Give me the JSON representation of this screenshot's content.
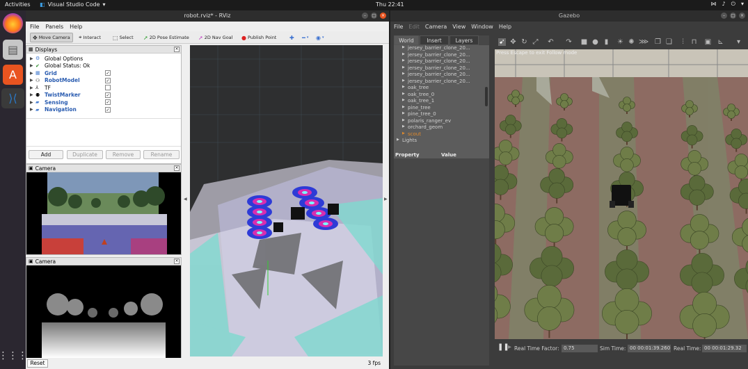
{
  "topbar": {
    "activities": "Activities",
    "app_name": "Visual Studio Code",
    "clock": "Thu 22:41"
  },
  "rviz": {
    "title": "robot.rviz* - RViz",
    "menu": [
      "File",
      "Panels",
      "Help"
    ],
    "tools": {
      "move_camera": "Move Camera",
      "interact": "Interact",
      "select": "Select",
      "pose_estimate": "2D Pose Estimate",
      "nav_goal": "2D Nav Goal",
      "publish_point": "Publish Point"
    },
    "displays": {
      "title": "Displays",
      "items": [
        {
          "label": "Global Options",
          "checked": "",
          "blue": false
        },
        {
          "label": "Global Status: Ok",
          "checked": "",
          "blue": false
        },
        {
          "label": "Grid",
          "checked": "✓",
          "blue": true
        },
        {
          "label": "RobotModel",
          "checked": "✓",
          "blue": true
        },
        {
          "label": "TF",
          "checked": "",
          "blue": false
        },
        {
          "label": "TwistMarker",
          "checked": "✓",
          "blue": true
        },
        {
          "label": "Sensing",
          "checked": "✓",
          "blue": true
        },
        {
          "label": "Navigation",
          "checked": "✓",
          "blue": true
        }
      ],
      "buttons": {
        "add": "Add",
        "duplicate": "Duplicate",
        "remove": "Remove",
        "rename": "Rename"
      }
    },
    "camera1_title": "Camera",
    "camera2_title": "Camera",
    "status": {
      "reset": "Reset",
      "fps": "3 fps"
    }
  },
  "gazebo": {
    "title": "Gazebo",
    "menu": {
      "file": "File",
      "edit": "Edit",
      "camera": "Camera",
      "view": "View",
      "window": "Window",
      "help": "Help"
    },
    "tabs": {
      "world": "World",
      "insert": "Insert",
      "layers": "Layers"
    },
    "tree_items": [
      "jersey_barrier_clone_20...",
      "jersey_barrier_clone_20...",
      "jersey_barrier_clone_20...",
      "jersey_barrier_clone_20...",
      "jersey_barrier_clone_20...",
      "jersey_barrier_clone_20...",
      "oak_tree",
      "oak_tree_0",
      "oak_tree_1",
      "pine_tree",
      "pine_tree_0",
      "polaris_ranger_ev",
      "orchard_geom",
      "scout",
      "Lights"
    ],
    "property_header": {
      "property": "Property",
      "value": "Value"
    },
    "scene_hint": "Press Escape to exit Follow mode",
    "status": {
      "rtf_label": "Real Time Factor:",
      "rtf_value": "0.75",
      "sim_label": "Sim Time:",
      "sim_value": "00 00:01:39.260",
      "real_label": "Real Time:",
      "real_value": "00 00:01:29.32"
    },
    "highlight_color": "#e08a2c"
  },
  "colors": {
    "ubuntu_orange": "#e95420",
    "vscode_blue": "#2a7acb"
  }
}
